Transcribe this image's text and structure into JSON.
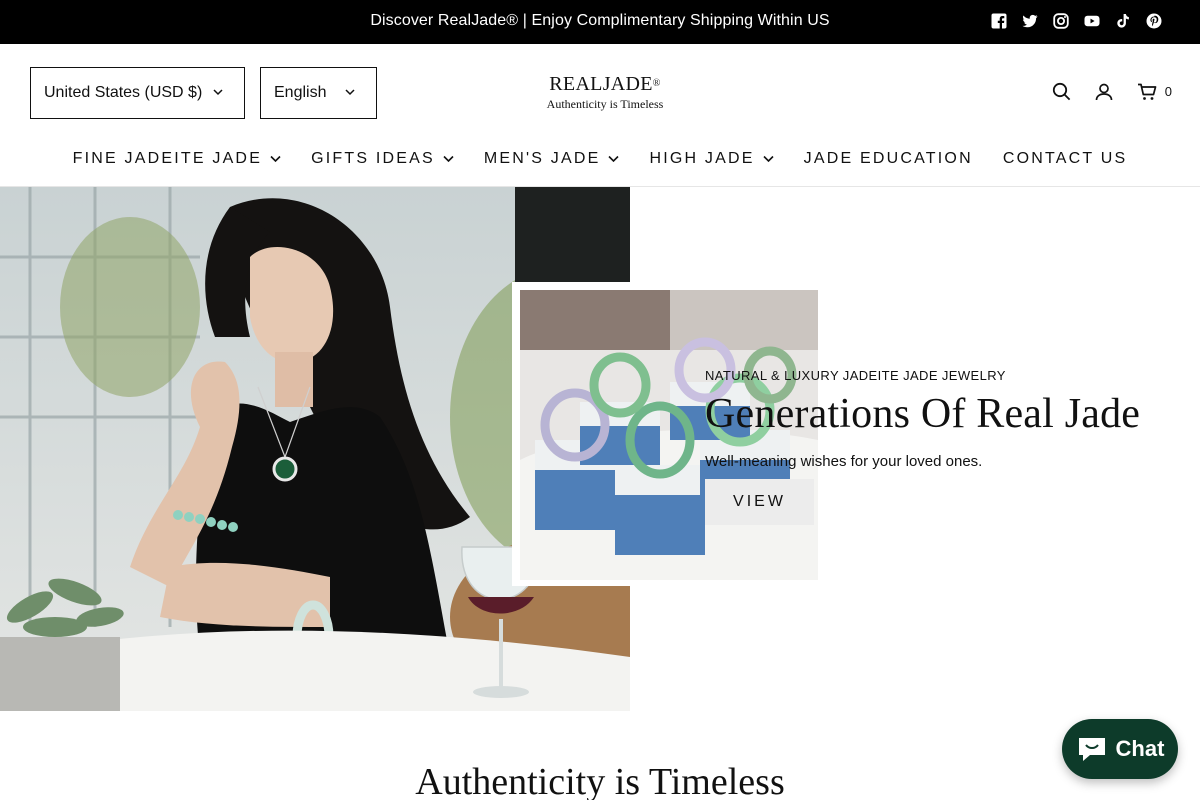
{
  "announcement": {
    "text": "Discover RealJade® | Enjoy Complimentary Shipping Within US",
    "socials": [
      "facebook-icon",
      "twitter-icon",
      "instagram-icon",
      "youtube-icon",
      "tiktok-icon",
      "pinterest-icon"
    ]
  },
  "header": {
    "currency": "United States (USD $)",
    "language": "English",
    "logo_main": "REALJADE",
    "logo_mark": "®",
    "logo_tagline": "Authenticity is Timeless",
    "cart_count": "0"
  },
  "nav": {
    "items": [
      {
        "label": "FINE JADEITE JADE",
        "dropdown": true
      },
      {
        "label": "GIFTS IDEAS",
        "dropdown": true
      },
      {
        "label": "MEN'S JADE",
        "dropdown": true
      },
      {
        "label": "HIGH JADE",
        "dropdown": true
      },
      {
        "label": "JADE EDUCATION",
        "dropdown": false
      },
      {
        "label": "CONTACT US",
        "dropdown": false
      }
    ]
  },
  "hero": {
    "subtitle": "NATURAL & LUXURY JADEITE JADE JEWELRY",
    "title": "Generations Of Real Jade",
    "description": "Well-meaning wishes for your loved ones.",
    "button": "VIEW"
  },
  "section": {
    "title": "Authenticity is Timeless"
  },
  "chat": {
    "label": "Chat"
  },
  "colors": {
    "announcement_bg": "#000000",
    "chat_bg": "#0d3b2a",
    "button_bg": "#ececec"
  }
}
